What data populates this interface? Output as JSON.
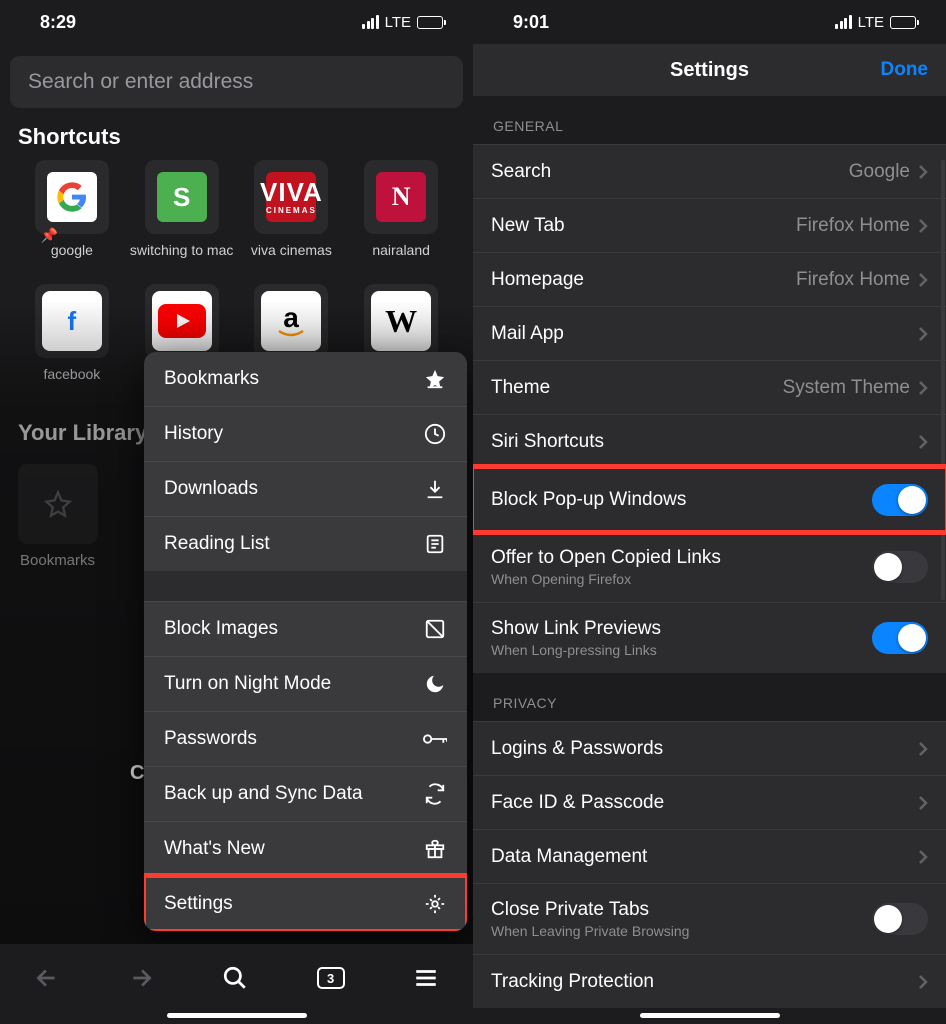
{
  "left": {
    "status": {
      "time": "8:29",
      "carrier": "LTE"
    },
    "search_placeholder": "Search or enter address",
    "shortcuts_title": "Shortcuts",
    "shortcuts_row1": [
      {
        "label": "google",
        "pinned": true
      },
      {
        "label": "switching to mac"
      },
      {
        "label": "viva cinemas"
      },
      {
        "label": "nairaland"
      }
    ],
    "shortcuts_row2": [
      {
        "label": "facebook"
      }
    ],
    "library_title": "Your Library",
    "library_item": "Bookmarks",
    "menu": [
      {
        "label": "Bookmarks",
        "icon": "star-filled-icon"
      },
      {
        "label": "History",
        "icon": "clock-icon"
      },
      {
        "label": "Downloads",
        "icon": "download-icon"
      },
      {
        "label": "Reading List",
        "icon": "reading-list-icon"
      },
      {
        "sep": true
      },
      {
        "label": "Block Images",
        "icon": "block-image-icon"
      },
      {
        "label": "Turn on Night Mode",
        "icon": "moon-icon"
      },
      {
        "label": "Passwords",
        "icon": "key-icon"
      },
      {
        "label": "Back up and Sync Data",
        "icon": "sync-icon"
      },
      {
        "label": "What's New",
        "icon": "gift-icon"
      },
      {
        "label": "Settings",
        "icon": "gear-icon",
        "highlight": true
      }
    ],
    "tab_count": "3"
  },
  "right": {
    "status": {
      "time": "9:01",
      "carrier": "LTE"
    },
    "nav": {
      "title": "Settings",
      "done": "Done"
    },
    "sections": {
      "general": {
        "header": "GENERAL",
        "rows": [
          {
            "title": "Search",
            "value": "Google",
            "chevron": true
          },
          {
            "title": "New Tab",
            "value": "Firefox Home",
            "chevron": true
          },
          {
            "title": "Homepage",
            "value": "Firefox Home",
            "chevron": true
          },
          {
            "title": "Mail App",
            "chevron": true
          },
          {
            "title": "Theme",
            "value": "System Theme",
            "chevron": true
          },
          {
            "title": "Siri Shortcuts",
            "chevron": true
          },
          {
            "title": "Block Pop-up Windows",
            "toggle": "on",
            "highlight": true
          },
          {
            "title": "Offer to Open Copied Links",
            "sub": "When Opening Firefox",
            "toggle": "off"
          },
          {
            "title": "Show Link Previews",
            "sub": "When Long-pressing Links",
            "toggle": "on"
          }
        ]
      },
      "privacy": {
        "header": "PRIVACY",
        "rows": [
          {
            "title": "Logins & Passwords",
            "chevron": true
          },
          {
            "title": "Face ID & Passcode",
            "chevron": true
          },
          {
            "title": "Data Management",
            "chevron": true
          },
          {
            "title": "Close Private Tabs",
            "sub": "When Leaving Private Browsing",
            "toggle": "off"
          },
          {
            "title": "Tracking Protection",
            "chevron": true
          }
        ]
      }
    }
  }
}
